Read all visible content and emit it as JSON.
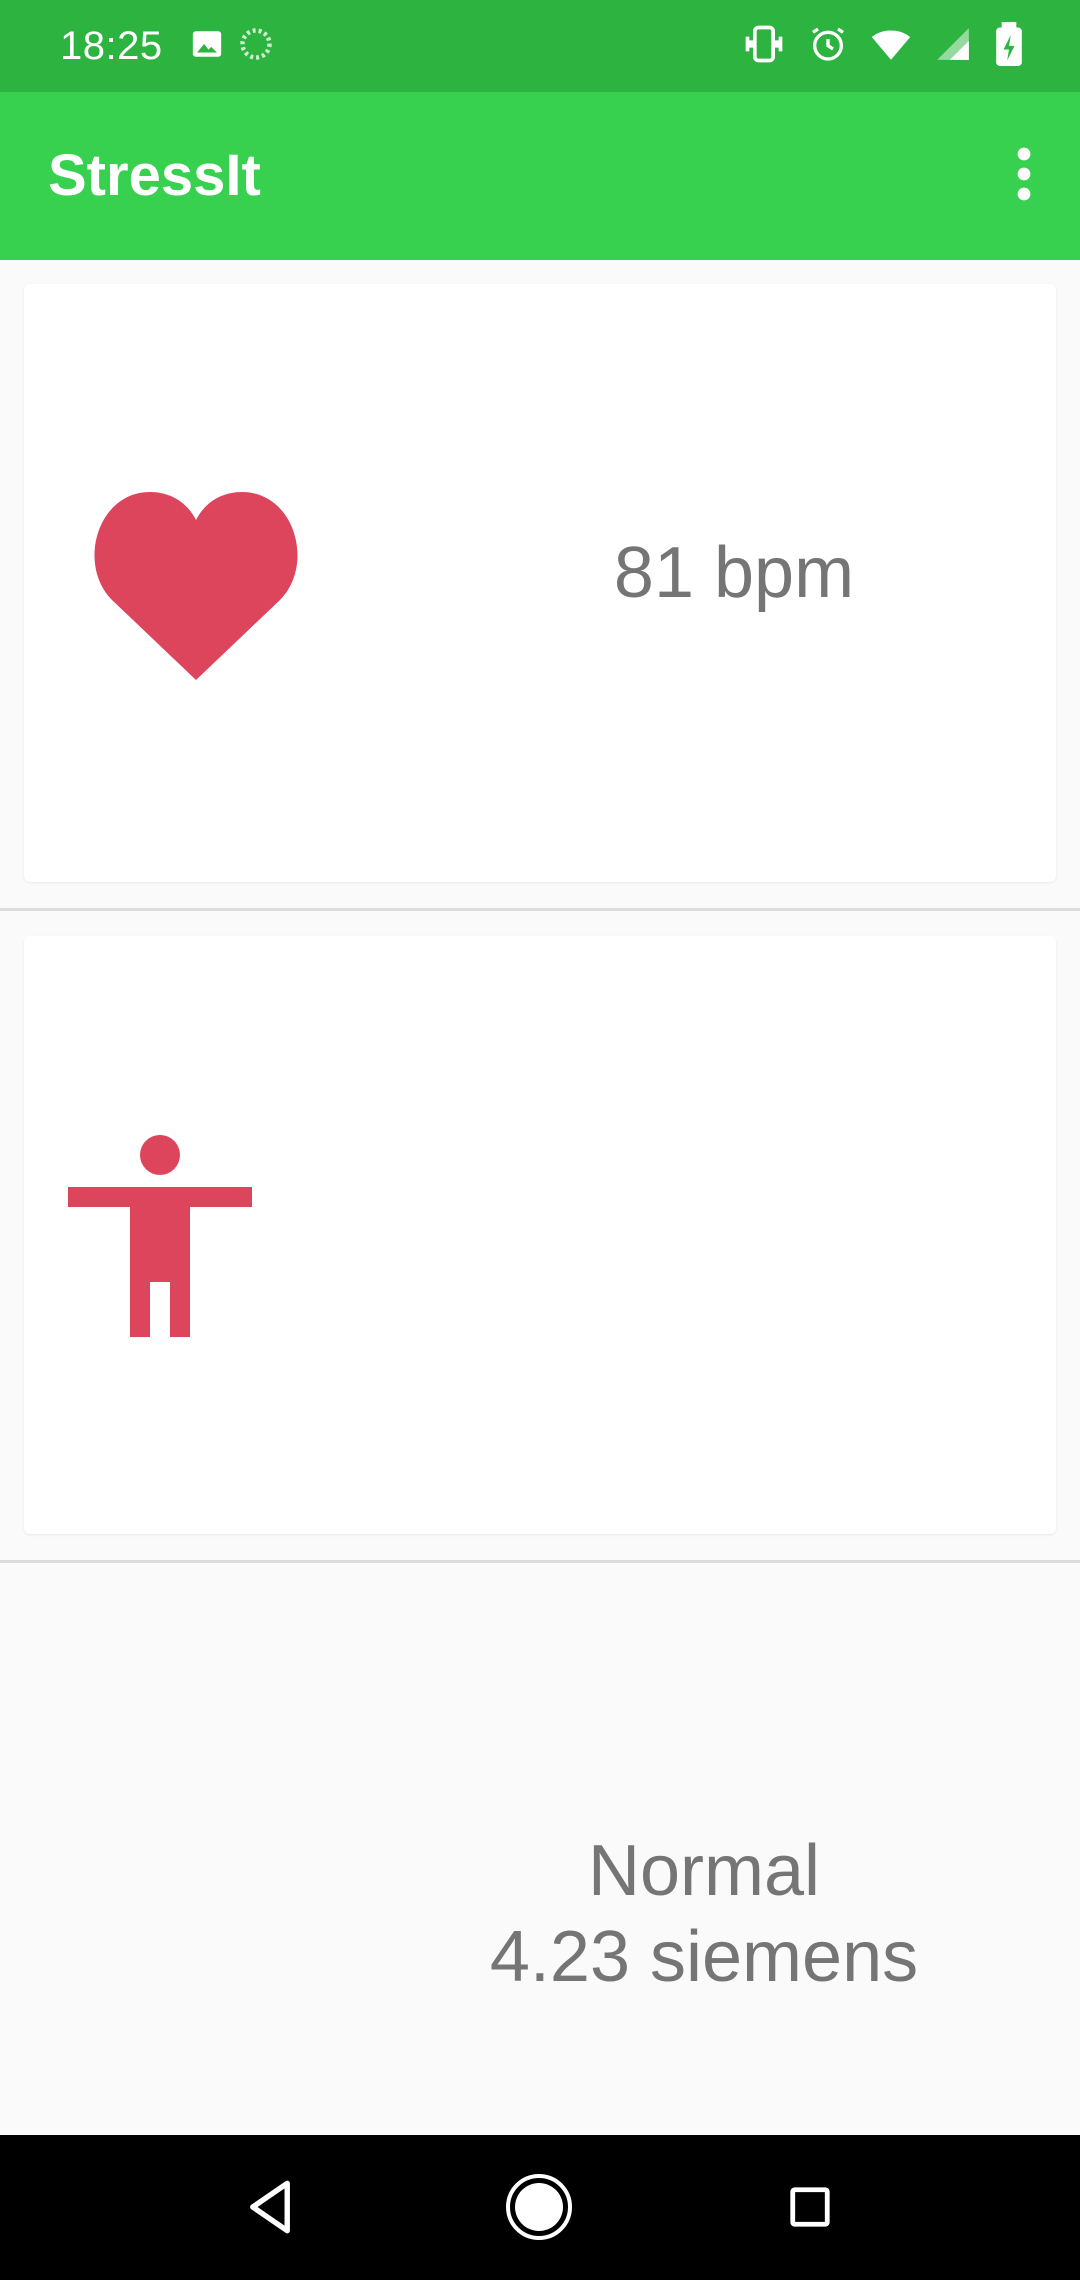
{
  "status_bar": {
    "time": "18:25",
    "left_icons": [
      "image-icon",
      "sync-icon"
    ],
    "right_icons": [
      "vibrate-icon",
      "alarm-icon",
      "wifi-icon",
      "signal-icon",
      "battery-charging-icon"
    ],
    "background_color": "#2db33f"
  },
  "app_bar": {
    "title": "StressIt",
    "overflow_icon": "more-vert-icon",
    "background_color": "#38d14f"
  },
  "cards": {
    "heart_rate": {
      "icon": "heart-icon",
      "value_text": "81 bpm"
    },
    "eda": {
      "icon": "body-icon",
      "state_text": "Normal",
      "value_text": "4.23 siemens"
    }
  },
  "colors": {
    "icon_accent": "#dc455b",
    "metric_text": "#757575"
  },
  "nav_bar": {
    "back_icon": "back-icon",
    "home_icon": "home-icon",
    "recents_icon": "recents-icon"
  }
}
